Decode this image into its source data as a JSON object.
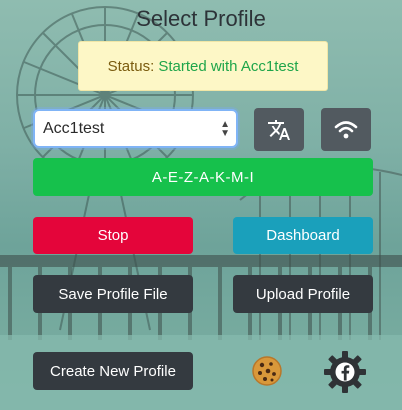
{
  "title": "Select Profile",
  "status": {
    "label": "Status:",
    "value": "Started with Acc1test"
  },
  "profile_select": {
    "value": "Acc1test"
  },
  "code_button": "A-E-Z-A-K-M-I",
  "buttons": {
    "stop": "Stop",
    "dashboard": "Dashboard",
    "save_profile": "Save Profile File",
    "upload_profile": "Upload Profile",
    "create_profile": "Create New Profile"
  },
  "icons": {
    "translate": "translate-icon",
    "wifi": "wifi-icon",
    "cookie": "cookie-icon",
    "settings": "gear-facebook-icon"
  },
  "colors": {
    "green": "#16c14c",
    "red": "#e4053a",
    "teal": "#1aa0bb",
    "dark": "#343a40",
    "status_bg": "#fdf7c6"
  }
}
